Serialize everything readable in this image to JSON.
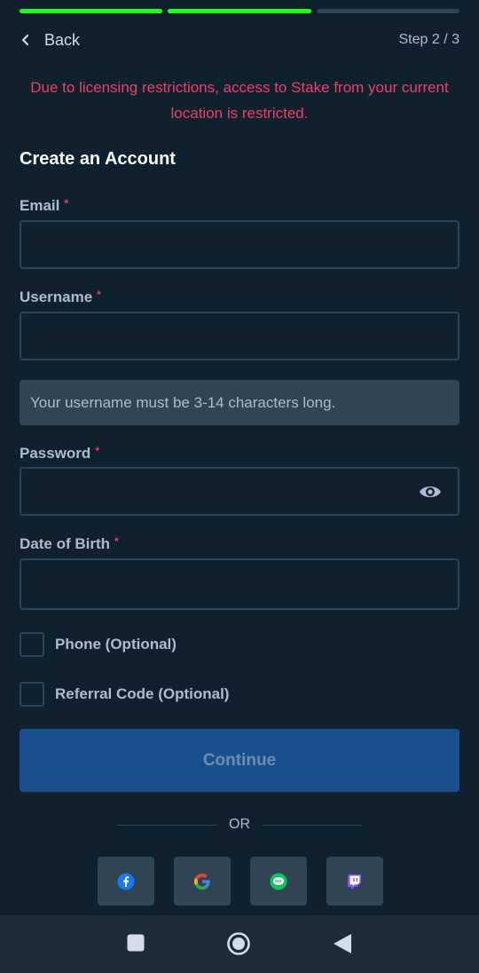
{
  "progress": {
    "total_steps": 3,
    "completed": 2
  },
  "header": {
    "back_label": "Back",
    "step_label": "Step 2 / 3"
  },
  "restriction_message": "Due to licensing restrictions, access to Stake from your current location is restricted.",
  "form": {
    "title": "Create an Account",
    "required_marker": "*",
    "email": {
      "label": "Email",
      "value": ""
    },
    "username": {
      "label": "Username",
      "value": "",
      "hint": "Your username must be 3-14 characters long."
    },
    "password": {
      "label": "Password",
      "value": ""
    },
    "dob": {
      "label": "Date of Birth",
      "value": ""
    },
    "phone_option": {
      "label": "Phone (Optional)",
      "checked": false
    },
    "referral_option": {
      "label": "Referral Code (Optional)",
      "checked": false
    },
    "continue_label": "Continue"
  },
  "divider": {
    "label": "OR"
  },
  "social_logins": [
    {
      "name": "facebook",
      "icon": "facebook-icon",
      "color": "#1877f2"
    },
    {
      "name": "google",
      "icon": "google-icon",
      "color": "#ea4335"
    },
    {
      "name": "line",
      "icon": "line-icon",
      "color": "#06c755"
    },
    {
      "name": "twitch",
      "icon": "twitch-icon",
      "color": "#9146ff"
    }
  ],
  "colors": {
    "background": "#0f212e",
    "progress_done": "#1fff20",
    "error": "#ed4163",
    "button": "#1a4e8c"
  },
  "system_nav": {
    "recent": "square-icon",
    "home": "circle-icon",
    "back": "triangle-back-icon"
  }
}
